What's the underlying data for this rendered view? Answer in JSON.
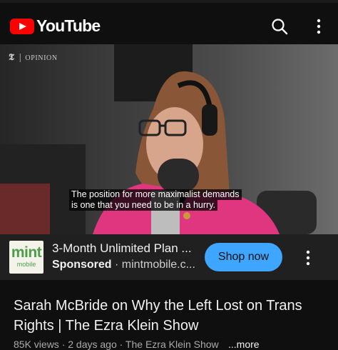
{
  "header": {
    "app_name": "YouTube",
    "icons": [
      "youtube-logo-icon",
      "search-icon",
      "more-vert-icon"
    ]
  },
  "video": {
    "watermark_logo": "𝕿",
    "watermark_text": "OPINION",
    "caption_line1": "The position for more maximalist demands",
    "caption_line2": "is one that you need to be in a hurry."
  },
  "ad": {
    "logo_line1": "mint",
    "logo_line2": "mobile",
    "title": "3-Month Unlimited Plan ...",
    "sponsored_label": "Sponsored",
    "separator": "·",
    "domain": "mintmobile.c...",
    "cta_label": "Shop now",
    "accent_color": "#3ea6ff"
  },
  "details": {
    "title": "Sarah McBride on Why the Left Lost on Trans Rights | The Ezra Klein Show",
    "meta": "85K views · 2 days ago · The Ezra Klein Show",
    "more_label": "...more"
  }
}
